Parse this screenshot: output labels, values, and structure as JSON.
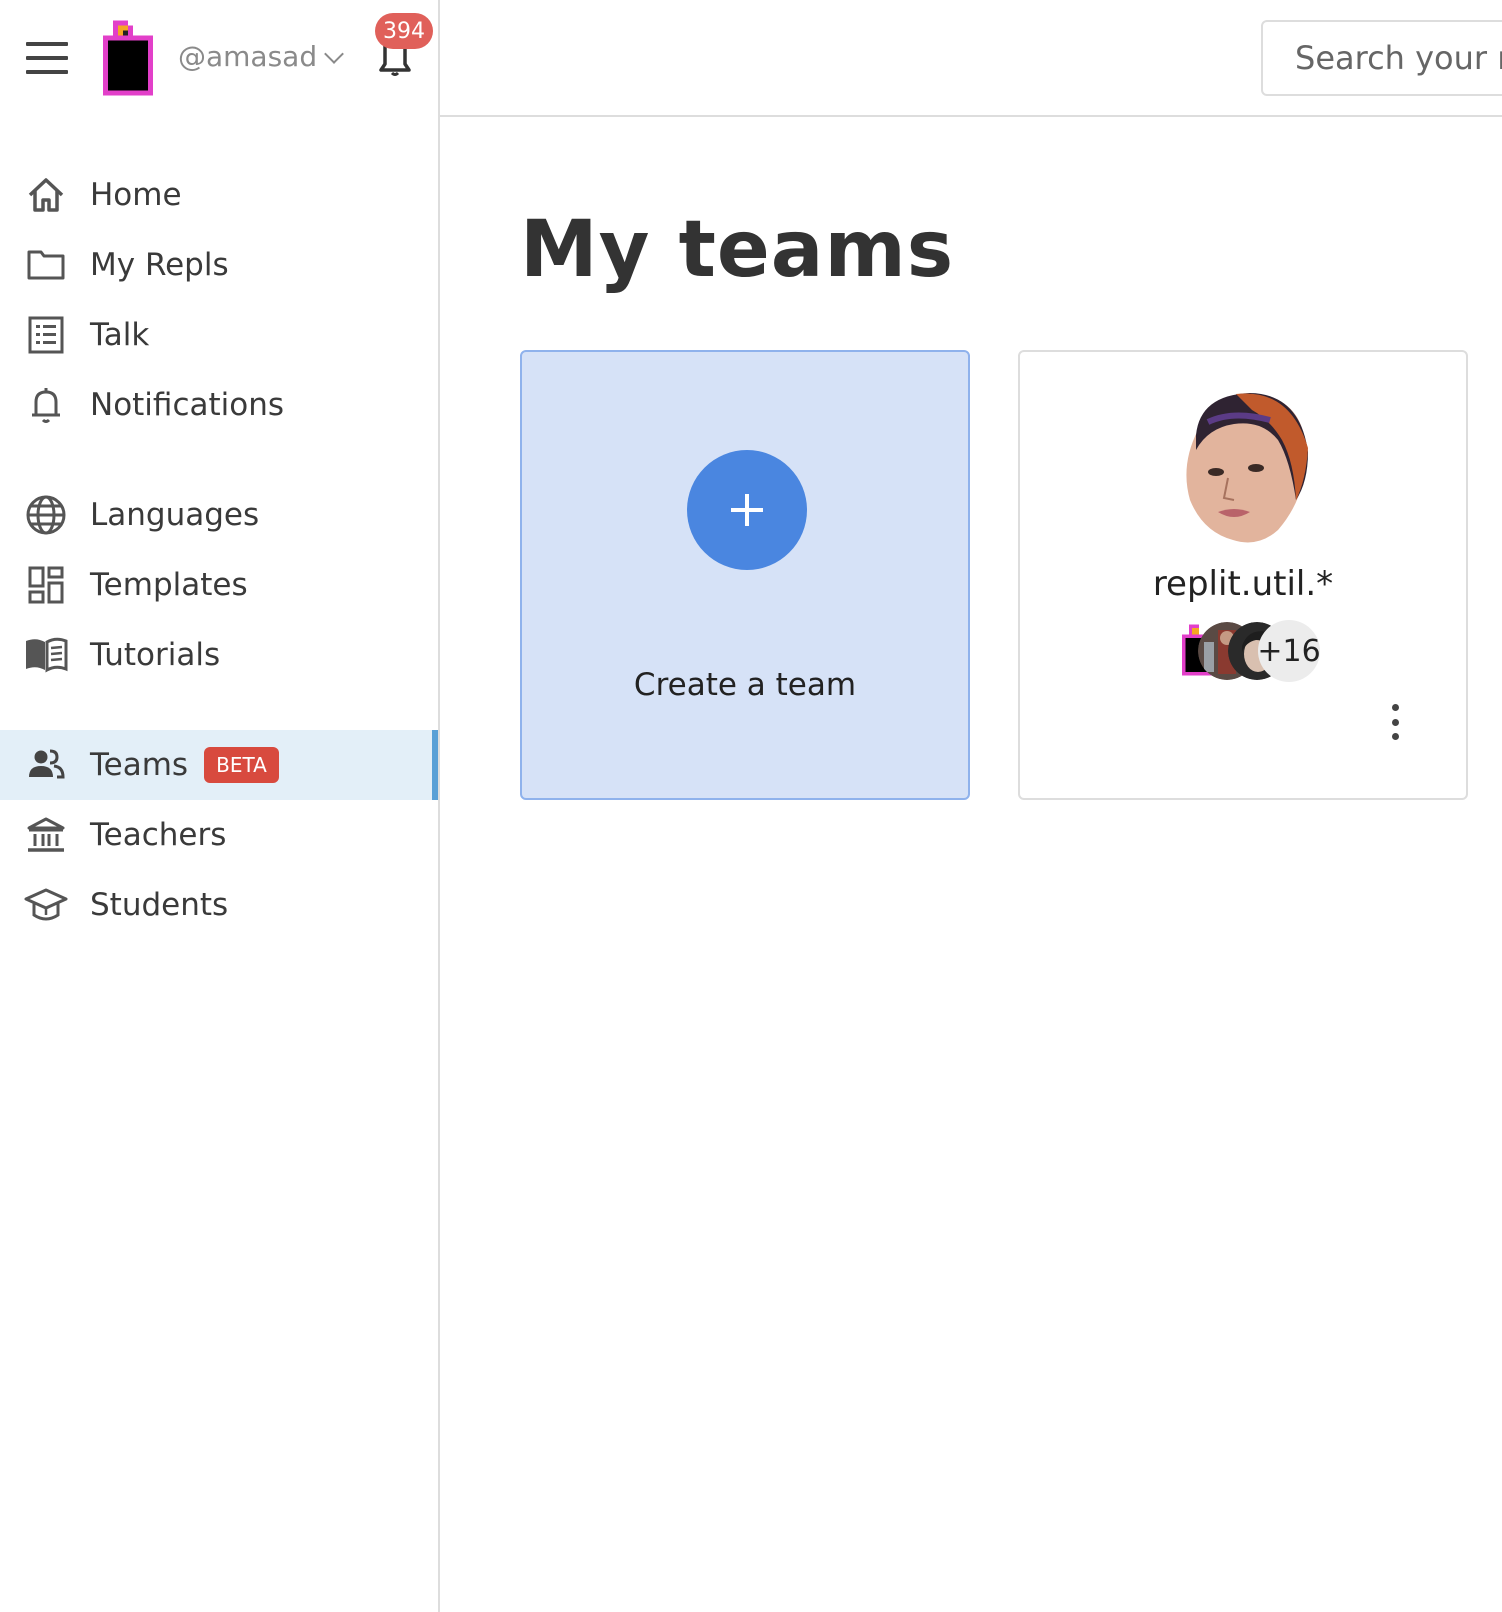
{
  "header": {
    "username": "@amasad",
    "notification_count": "394",
    "search_placeholder": "Search your re"
  },
  "sidebar": {
    "items": [
      {
        "label": "Home",
        "icon": "home-icon"
      },
      {
        "label": "My Repls",
        "icon": "folder-icon"
      },
      {
        "label": "Talk",
        "icon": "list-icon"
      },
      {
        "label": "Notifications",
        "icon": "bell-icon"
      },
      {
        "label": "Languages",
        "icon": "globe-icon"
      },
      {
        "label": "Templates",
        "icon": "dashboard-icon"
      },
      {
        "label": "Tutorials",
        "icon": "book-icon"
      },
      {
        "label": "Teams",
        "icon": "people-icon",
        "badge": "BETA",
        "active": true
      },
      {
        "label": "Teachers",
        "icon": "institution-icon"
      },
      {
        "label": "Students",
        "icon": "graduation-cap-icon"
      }
    ]
  },
  "main": {
    "title": "My teams",
    "create_card": {
      "label": "Create a team"
    },
    "teams": [
      {
        "name": "replit.util.*",
        "extra_members": "+16"
      }
    ]
  },
  "colors": {
    "accent": "#4a86e0",
    "badge": "#e0605a",
    "beta": "#d84a3e",
    "active_bg": "#e3eff8",
    "active_bar": "#5aa0d6",
    "create_bg": "#d6e2f7"
  }
}
